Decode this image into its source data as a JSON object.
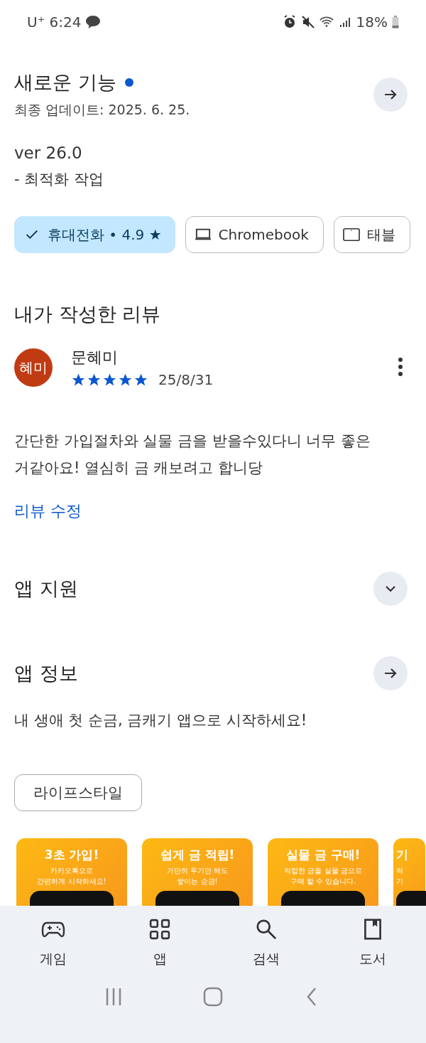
{
  "status_bar": {
    "carrier": "U⁺",
    "time": "6:24",
    "battery": "18%"
  },
  "whats_new": {
    "title": "새로운 기능",
    "updated": "최종 업데이트: 2025. 6. 25.",
    "version": "ver 26.0",
    "notes": "- 최적화 작업"
  },
  "device_chips": [
    {
      "label": "휴대전화 • 4.9 ★",
      "selected": true
    },
    {
      "label": "Chromebook",
      "kind": "laptop",
      "selected": false
    },
    {
      "label": "태블",
      "kind": "tablet",
      "selected": false
    }
  ],
  "my_review": {
    "heading": "내가 작성한 리뷰",
    "avatar": "혜미",
    "author": "문혜미",
    "stars": 5,
    "date": "25/8/31",
    "text": "간단한 가입절차와 실물 금을 받을수있다니 너무 좋은거같아요! 열심히 금 캐보려고 합니당",
    "edit_link": "리뷰 수정"
  },
  "app_support": {
    "title": "앱 지원",
    "expanded": false
  },
  "app_info": {
    "title": "앱 정보",
    "description": "내 생애 첫 순금, 금캐기 앱으로 시작하세요!",
    "category": "라이프스타일"
  },
  "screenshots": [
    {
      "title": "3초 가입!",
      "lines": [
        "카카오톡으로",
        "간편하게 시작하세요!"
      ]
    },
    {
      "title": "쉽게 금 적립!",
      "lines": [
        "가만히 두기만 해도",
        "쌓이는 순금!"
      ]
    },
    {
      "title": "실물 금 구매!",
      "lines": [
        "적립한 금을 실물 금으로",
        "구매 할 수 있습니다."
      ]
    },
    {
      "title": "기",
      "lines": [
        "적",
        "기"
      ]
    }
  ],
  "bottom_nav": [
    {
      "label": "게임",
      "kind": "games",
      "selected": false
    },
    {
      "label": "앱",
      "kind": "apps",
      "selected": false
    },
    {
      "label": "검색",
      "kind": "search",
      "selected": false
    },
    {
      "label": "도서",
      "kind": "books",
      "selected": false
    }
  ]
}
